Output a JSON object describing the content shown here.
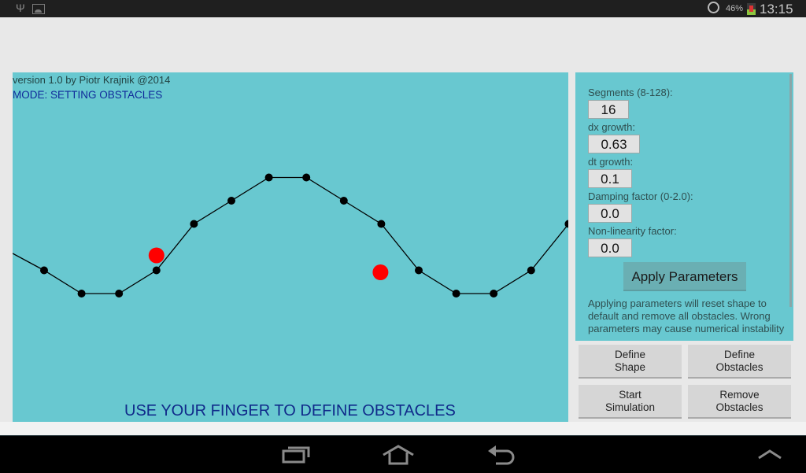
{
  "status_bar": {
    "left_icons": [
      "usb-icon",
      "gallery-icon"
    ],
    "alarm_icon": "alarm-clock-icon",
    "battery_percent": "46%",
    "battery_icon": "battery-charging-icon",
    "time": "13:15"
  },
  "canvas": {
    "version_text": "version 1.0 by Piotr Krajnik @2014",
    "mode_text": "MODE: SETTING OBSTACLES",
    "hint_text": "USE YOUR FINGER TO DEFINE OBSTACLES",
    "background_color": "#68c8d0",
    "curve": {
      "segments": 16,
      "point_color": "#000000",
      "points_y_rel": [
        0.0,
        0.25,
        0.5,
        0.5,
        0.25,
        -0.25,
        -0.5,
        -0.75,
        -0.75,
        -0.5,
        -0.25,
        0.25,
        0.5,
        0.5,
        0.25,
        -0.25
      ],
      "note": "points_y_rel: displacement of each node relative to rest line, unit = half amplitude"
    },
    "obstacles": [
      {
        "segment_index": 4,
        "offset": "above curve"
      },
      {
        "segment_index": 10,
        "offset": "below curve"
      }
    ],
    "obstacle_color": "#ff0000"
  },
  "panel": {
    "fields": [
      {
        "label": "Segments (8-128):",
        "value": "16"
      },
      {
        "label": "dx growth:",
        "value": "0.63"
      },
      {
        "label": "dt growth:",
        "value": "0.1"
      },
      {
        "label": "Damping factor (0-2.0):",
        "value": "0.0"
      },
      {
        "label": "Non-linearity factor:",
        "value": "0.0"
      }
    ],
    "apply_button": "Apply Parameters",
    "note": "Applying parameters will reset shape to default and remove all obstacles. Wrong parameters may cause numerical instability"
  },
  "buttons": {
    "define_shape": [
      "Define",
      "Shape"
    ],
    "define_obstacles": [
      "Define",
      "Obstacles"
    ],
    "start_simulation": [
      "Start",
      "Simulation"
    ],
    "remove_obstacles": [
      "Remove",
      "Obstacles"
    ]
  },
  "nav_bar": {
    "icons": [
      "recent-apps-icon",
      "home-icon",
      "back-icon",
      "menu-up-icon"
    ]
  }
}
